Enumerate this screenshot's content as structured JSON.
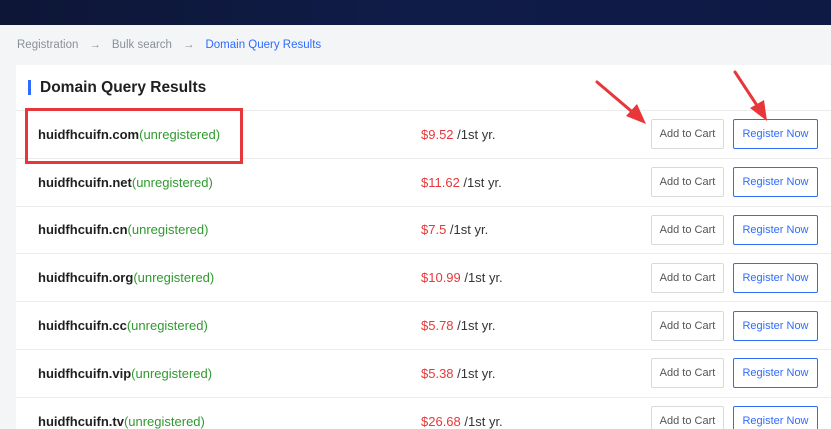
{
  "breadcrumb": {
    "items": [
      "Registration",
      "Bulk search",
      "Domain Query Results"
    ],
    "separator": "→"
  },
  "panel": {
    "title": "Domain Query Results"
  },
  "buttons": {
    "add_to_cart": "Add to Cart",
    "register_now": "Register Now"
  },
  "results": [
    {
      "name": "huidfhcuifn.com",
      "status": "(unregistered)",
      "price": "$9.52",
      "period": " /1st yr."
    },
    {
      "name": "huidfhcuifn.net",
      "status": "(unregistered)",
      "price": "$11.62",
      "period": " /1st yr."
    },
    {
      "name": "huidfhcuifn.cn",
      "status": "(unregistered)",
      "price": "$7.5",
      "period": " /1st yr."
    },
    {
      "name": "huidfhcuifn.org",
      "status": "(unregistered)",
      "price": "$10.99",
      "period": " /1st yr."
    },
    {
      "name": "huidfhcuifn.cc",
      "status": "(unregistered)",
      "price": "$5.78",
      "period": " /1st yr."
    },
    {
      "name": "huidfhcuifn.vip",
      "status": "(unregistered)",
      "price": "$5.38",
      "period": " /1st yr."
    },
    {
      "name": "huidfhcuifn.tv",
      "status": "(unregistered)",
      "price": "$26.68",
      "period": " /1st yr."
    }
  ],
  "colors": {
    "accent": "#2f6bff",
    "price": "#e8373a",
    "status": "#2f9a2f",
    "annotation": "#e8373a"
  }
}
